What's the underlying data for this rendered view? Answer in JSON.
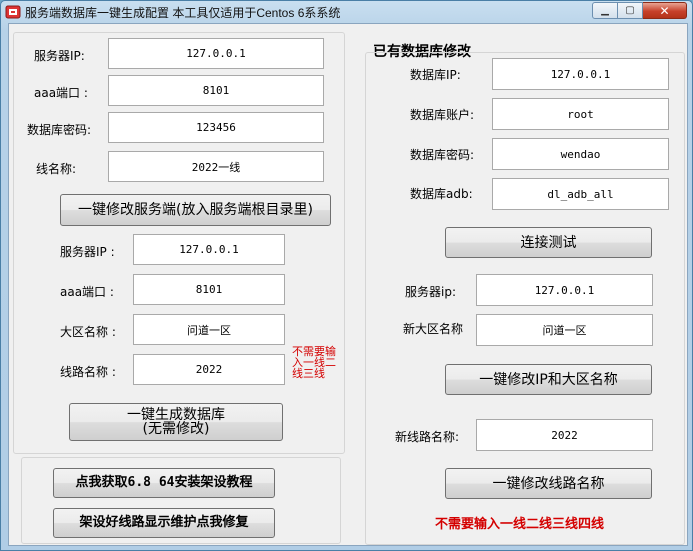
{
  "window": {
    "title": "服务端数据库一键生成配置 本工具仅适用于Centos 6系系统"
  },
  "left": {
    "server_ip_label": "服务器IP:",
    "server_ip_value": "127.0.0.1",
    "aaa_port_label": "aaa端口 :",
    "aaa_port_value": "8101",
    "db_password_label": "数据库密码:",
    "db_password_value": "123456",
    "line_name_label": "线名称:",
    "line_name_value": "2022一线",
    "modify_server_button": "一键修改服务端(放入服务端根目录里)",
    "server_ip2_label": "服务器IP :",
    "server_ip2_value": "127.0.0.1",
    "aaa_port2_label": "aaa端口 :",
    "aaa_port2_value": "8101",
    "region_name_label": "大区名称 :",
    "region_name_value": "问道一区",
    "route_name_label": "线路名称 :",
    "route_name_value": "2022",
    "route_note_1": "不需要输",
    "route_note_2": "入一线二",
    "route_note_3": "线三线",
    "generate_db_button_line1": "一键生成数据库",
    "generate_db_button_line2": "(无需修改)",
    "tutorial_button": "点我获取6.8 64安装架设教程",
    "fix_button": "架设好线路显示维护点我修复"
  },
  "right": {
    "heading": "已有数据库修改",
    "db_ip_label": "数据库IP:",
    "db_ip_value": "127.0.0.1",
    "db_account_label": "数据库账户:",
    "db_account_value": "root",
    "db_password_label": "数据库密码:",
    "db_password_value": "wendao",
    "db_adb_label": "数据库adb:",
    "db_adb_value": "dl_adb_all",
    "connect_test_button": "连接测试",
    "server_ip_label": "服务器ip:",
    "server_ip_value": "127.0.0.1",
    "new_region_label": "新大区名称",
    "new_region_value": "问道一区",
    "modify_ip_region_button": "一键修改IP和大区名称",
    "new_route_label": "新线路名称:",
    "new_route_value": "2022",
    "modify_route_button": "一键修改线路名称",
    "note": "不需要输入一线二线三线四线"
  },
  "colors": {
    "note_red": "#d40000",
    "title_gradient_top": "#c9dff0"
  }
}
